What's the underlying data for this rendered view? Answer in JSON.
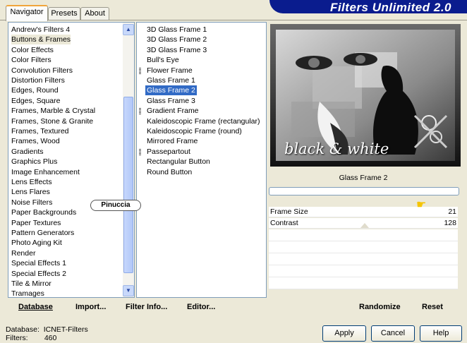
{
  "tabs": [
    {
      "label": "Navigator",
      "active": true
    },
    {
      "label": "Presets",
      "active": false
    },
    {
      "label": "About",
      "active": false
    }
  ],
  "title": "Filters Unlimited 2.0",
  "categories": {
    "items": [
      "Andrew's Filters 4",
      "Buttons & Frames",
      "Color Effects",
      "Color Filters",
      "Convolution Filters",
      "Distortion Filters",
      "Edges, Round",
      "Edges, Square",
      "Frames, Marble & Crystal",
      "Frames, Stone & Granite",
      "Frames, Textured",
      "Frames, Wood",
      "Gradients",
      "Graphics Plus",
      "Image Enhancement",
      "Lens Effects",
      "Lens Flares",
      "Noise Filters",
      "Paper Backgrounds",
      "Paper Textures",
      "Pattern Generators",
      "Photo Aging Kit",
      "Render",
      "Special Effects 1",
      "Special Effects 2",
      "Tile & Mirror",
      "Tramages"
    ],
    "selected": "Buttons & Frames"
  },
  "filters": {
    "items": [
      {
        "label": "3D Glass Frame 1",
        "grip": false
      },
      {
        "label": "3D Glass Frame 2",
        "grip": false
      },
      {
        "label": "3D Glass Frame 3",
        "grip": false
      },
      {
        "label": "Bull's Eye",
        "grip": false
      },
      {
        "label": "Flower Frame",
        "grip": true
      },
      {
        "label": "Glass Frame 1",
        "grip": false
      },
      {
        "label": "Glass Frame 2",
        "grip": false
      },
      {
        "label": "Glass Frame 3",
        "grip": false
      },
      {
        "label": "Gradient Frame",
        "grip": true
      },
      {
        "label": "Kaleidoscopic Frame (rectangular)",
        "grip": false
      },
      {
        "label": "Kaleidoscopic Frame (round)",
        "grip": false
      },
      {
        "label": "Mirrored Frame",
        "grip": false
      },
      {
        "label": "Passepartout",
        "grip": true
      },
      {
        "label": "Rectangular Button",
        "grip": false
      },
      {
        "label": "Round Button",
        "grip": false
      }
    ],
    "selected": "Glass Frame 2"
  },
  "signature": "Pinuccia",
  "preview": {
    "caption": "Glass Frame 2",
    "watermark": "black & white"
  },
  "parameters": [
    {
      "label": "Frame Size",
      "value": "21",
      "fraction": 0.08
    },
    {
      "label": "Contrast",
      "value": "128",
      "fraction": 0.5
    }
  ],
  "toolbar": {
    "database": "Database",
    "import": "Import...",
    "filter_info": "Filter Info...",
    "editor": "Editor...",
    "randomize": "Randomize",
    "reset": "Reset"
  },
  "status": {
    "database_label": "Database:",
    "database_value": "ICNET-Filters",
    "filters_label": "Filters:",
    "filters_value": "460"
  },
  "buttons": {
    "apply": "Apply",
    "cancel": "Cancel",
    "help": "Help"
  },
  "colors": {
    "title_bar": "#0a1c8e",
    "selection": "#316ac5",
    "tab_accent": "#f1a53b"
  }
}
